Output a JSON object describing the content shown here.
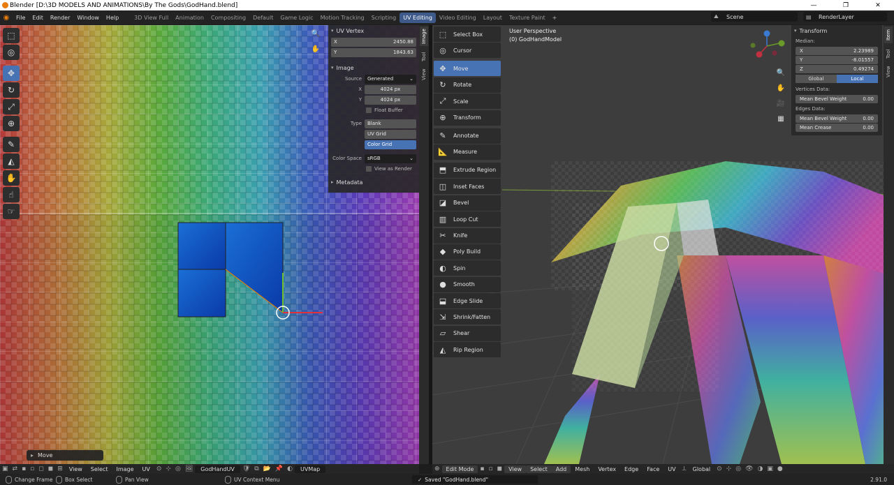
{
  "window": {
    "title": "Blender [D:\\3D MODELS AND ANIMATIONS\\By The Gods\\GodHand.blend]",
    "buttons": [
      "—",
      "❐",
      "✕"
    ]
  },
  "menubar": {
    "menus": [
      "File",
      "Edit",
      "Render",
      "Window",
      "Help"
    ],
    "tabs": [
      "3D View Full",
      "Animation",
      "Compositing",
      "Default",
      "Game Logic",
      "Motion Tracking",
      "Scripting",
      "UV Editing",
      "Video Editing",
      "Layout",
      "Texture Paint"
    ],
    "active_tab": "UV Editing",
    "add_tab": "+",
    "scene": "Scene",
    "render_layer": "RenderLayer"
  },
  "uv_editor": {
    "sidebar_tabs": [
      "Image",
      "Tool",
      "View"
    ],
    "uv_vertex": {
      "title": "UV Vertex",
      "x_label": "X",
      "x_value": "2450.88",
      "y_label": "Y",
      "y_value": "1843.63"
    },
    "image": {
      "title": "Image",
      "source_label": "Source",
      "source_value": "Generated",
      "x_label": "X",
      "x_value": "4024 px",
      "y_label": "Y",
      "y_value": "4024 px",
      "float_buffer": "Float Buffer",
      "type_label": "Type",
      "type_options": [
        "Blank",
        "UV Grid",
        "Color Grid"
      ],
      "type_selected": "Color Grid",
      "color_space_label": "Color Space",
      "color_space_value": "sRGB",
      "view_as_render": "View as Render"
    },
    "metadata": {
      "title": "Metadata"
    },
    "last_operator": "Move",
    "header": {
      "menus": [
        "View",
        "Select",
        "Image",
        "UV"
      ],
      "image_name": "GodHandUV",
      "uvmap": "UVMap"
    }
  },
  "viewport": {
    "label_view": "User Perspective",
    "label_object": "(0) GodHandModel",
    "tools": [
      {
        "label": "Select Box",
        "icon": "select-box-icon",
        "glyph": "⬚"
      },
      {
        "label": "Cursor",
        "icon": "cursor-icon",
        "glyph": "◎"
      },
      {
        "label": "Move",
        "icon": "move-icon",
        "glyph": "✥",
        "active": true
      },
      {
        "label": "Rotate",
        "icon": "rotate-icon",
        "glyph": "↻"
      },
      {
        "label": "Scale",
        "icon": "scale-icon",
        "glyph": "⤢"
      },
      {
        "label": "Transform",
        "icon": "transform-icon",
        "glyph": "⊕"
      },
      {
        "label": "Annotate",
        "icon": "annotate-icon",
        "glyph": "✎"
      },
      {
        "label": "Measure",
        "icon": "measure-icon",
        "glyph": "📐"
      },
      {
        "label": "Extrude Region",
        "icon": "extrude-icon",
        "glyph": "⬒"
      },
      {
        "label": "Inset Faces",
        "icon": "inset-icon",
        "glyph": "◫"
      },
      {
        "label": "Bevel",
        "icon": "bevel-icon",
        "glyph": "◪"
      },
      {
        "label": "Loop Cut",
        "icon": "loop-cut-icon",
        "glyph": "▥"
      },
      {
        "label": "Knife",
        "icon": "knife-icon",
        "glyph": "✂"
      },
      {
        "label": "Poly Build",
        "icon": "poly-build-icon",
        "glyph": "◆"
      },
      {
        "label": "Spin",
        "icon": "spin-icon",
        "glyph": "◐"
      },
      {
        "label": "Smooth",
        "icon": "smooth-icon",
        "glyph": "●"
      },
      {
        "label": "Edge Slide",
        "icon": "edge-slide-icon",
        "glyph": "⬓"
      },
      {
        "label": "Shrink/Fatten",
        "icon": "shrink-fatten-icon",
        "glyph": "⇲"
      },
      {
        "label": "Shear",
        "icon": "shear-icon",
        "glyph": "▱"
      },
      {
        "label": "Rip Region",
        "icon": "rip-icon",
        "glyph": "◭"
      }
    ],
    "transform": {
      "title": "Transform",
      "median_label": "Median:",
      "x_label": "X",
      "x_value": "2.23989",
      "y_label": "Y",
      "y_value": "-8.01557",
      "z_label": "Z",
      "z_value": "0.49274",
      "global": "Global",
      "local": "Local",
      "vertices_data": "Vertices Data:",
      "mean_bevel_weight_v": "Mean Bevel Weight",
      "mean_bevel_weight_v_value": "0.00",
      "edges_data": "Edges Data:",
      "mean_bevel_weight_e": "Mean Bevel Weight",
      "mean_bevel_weight_e_value": "0.00",
      "mean_crease": "Mean Crease",
      "mean_crease_value": "0.00"
    },
    "sidebar_tabs": [
      "Item",
      "Tool",
      "View"
    ],
    "header": {
      "mode": "Edit Mode",
      "menus": [
        "View",
        "Select",
        "Add",
        "Mesh",
        "Vertex",
        "Edge",
        "Face",
        "UV"
      ],
      "orientation": "Global"
    },
    "gizmo": {
      "x": "X",
      "y": "Y",
      "z": "Z"
    }
  },
  "statusbar": {
    "change_frame": "Change Frame",
    "box_select": "Box Select",
    "pan_view": "Pan View",
    "uv_context_menu": "UV Context Menu",
    "saved": "Saved \"GodHand.blend\"",
    "version": "2.91.0"
  },
  "colors": {
    "accent": "#4772b3",
    "header": "#232323",
    "panel": "#282828",
    "selected_face": "#1a63c8"
  }
}
